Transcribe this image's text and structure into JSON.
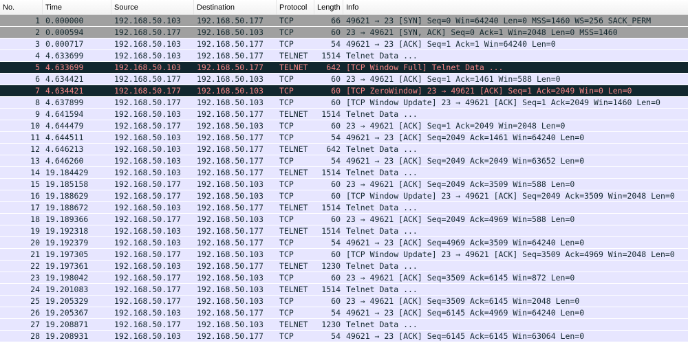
{
  "columns": {
    "no": "No.",
    "time": "Time",
    "source": "Source",
    "destination": "Destination",
    "protocol": "Protocol",
    "length": "Length",
    "info": "Info"
  },
  "colors": {
    "row_default": "#e7e6ff",
    "row_syn": "#a0a0a0",
    "row_bad_bg": "#12272e",
    "row_bad_fg": "#f78787"
  },
  "packets": [
    {
      "no": "1",
      "time": "0.000000",
      "source": "192.168.50.103",
      "destination": "192.168.50.177",
      "protocol": "TCP",
      "length": "66",
      "info": "49621 → 23 [SYN] Seq=0 Win=64240 Len=0 MSS=1460 WS=256 SACK_PERM",
      "style": "syn"
    },
    {
      "no": "2",
      "time": "0.000594",
      "source": "192.168.50.177",
      "destination": "192.168.50.103",
      "protocol": "TCP",
      "length": "60",
      "info": "23 → 49621 [SYN, ACK] Seq=0 Ack=1 Win=2048 Len=0 MSS=1460",
      "style": "syn"
    },
    {
      "no": "3",
      "time": "0.000717",
      "source": "192.168.50.103",
      "destination": "192.168.50.177",
      "protocol": "TCP",
      "length": "54",
      "info": "49621 → 23 [ACK] Seq=1 Ack=1 Win=64240 Len=0",
      "style": "normal"
    },
    {
      "no": "4",
      "time": "4.633699",
      "source": "192.168.50.103",
      "destination": "192.168.50.177",
      "protocol": "TELNET",
      "length": "1514",
      "info": "Telnet Data ...",
      "style": "normal"
    },
    {
      "no": "5",
      "time": "4.633699",
      "source": "192.168.50.103",
      "destination": "192.168.50.177",
      "protocol": "TELNET",
      "length": "642",
      "info": "[TCP Window Full] Telnet Data ...",
      "style": "bad"
    },
    {
      "no": "6",
      "time": "4.634421",
      "source": "192.168.50.177",
      "destination": "192.168.50.103",
      "protocol": "TCP",
      "length": "60",
      "info": "23 → 49621 [ACK] Seq=1 Ack=1461 Win=588 Len=0",
      "style": "normal"
    },
    {
      "no": "7",
      "time": "4.634421",
      "source": "192.168.50.177",
      "destination": "192.168.50.103",
      "protocol": "TCP",
      "length": "60",
      "info": "[TCP ZeroWindow] 23 → 49621 [ACK] Seq=1 Ack=2049 Win=0 Len=0",
      "style": "bad"
    },
    {
      "no": "8",
      "time": "4.637899",
      "source": "192.168.50.177",
      "destination": "192.168.50.103",
      "protocol": "TCP",
      "length": "60",
      "info": "[TCP Window Update] 23 → 49621 [ACK] Seq=1 Ack=2049 Win=1460 Len=0",
      "style": "normal"
    },
    {
      "no": "9",
      "time": "4.641594",
      "source": "192.168.50.103",
      "destination": "192.168.50.177",
      "protocol": "TELNET",
      "length": "1514",
      "info": "Telnet Data ...",
      "style": "normal"
    },
    {
      "no": "10",
      "time": "4.644479",
      "source": "192.168.50.177",
      "destination": "192.168.50.103",
      "protocol": "TCP",
      "length": "60",
      "info": "23 → 49621 [ACK] Seq=1 Ack=2049 Win=2048 Len=0",
      "style": "normal"
    },
    {
      "no": "11",
      "time": "4.644511",
      "source": "192.168.50.103",
      "destination": "192.168.50.177",
      "protocol": "TCP",
      "length": "54",
      "info": "49621 → 23 [ACK] Seq=2049 Ack=1461 Win=64240 Len=0",
      "style": "normal"
    },
    {
      "no": "12",
      "time": "4.646213",
      "source": "192.168.50.103",
      "destination": "192.168.50.177",
      "protocol": "TELNET",
      "length": "642",
      "info": "Telnet Data ...",
      "style": "normal"
    },
    {
      "no": "13",
      "time": "4.646260",
      "source": "192.168.50.103",
      "destination": "192.168.50.177",
      "protocol": "TCP",
      "length": "54",
      "info": "49621 → 23 [ACK] Seq=2049 Ack=2049 Win=63652 Len=0",
      "style": "normal"
    },
    {
      "no": "14",
      "time": "19.184429",
      "source": "192.168.50.103",
      "destination": "192.168.50.177",
      "protocol": "TELNET",
      "length": "1514",
      "info": "Telnet Data ...",
      "style": "normal"
    },
    {
      "no": "15",
      "time": "19.185158",
      "source": "192.168.50.177",
      "destination": "192.168.50.103",
      "protocol": "TCP",
      "length": "60",
      "info": "23 → 49621 [ACK] Seq=2049 Ack=3509 Win=588 Len=0",
      "style": "normal"
    },
    {
      "no": "16",
      "time": "19.188629",
      "source": "192.168.50.177",
      "destination": "192.168.50.103",
      "protocol": "TCP",
      "length": "60",
      "info": "[TCP Window Update] 23 → 49621 [ACK] Seq=2049 Ack=3509 Win=2048 Len=0",
      "style": "normal"
    },
    {
      "no": "17",
      "time": "19.188672",
      "source": "192.168.50.103",
      "destination": "192.168.50.177",
      "protocol": "TELNET",
      "length": "1514",
      "info": "Telnet Data ...",
      "style": "normal"
    },
    {
      "no": "18",
      "time": "19.189366",
      "source": "192.168.50.177",
      "destination": "192.168.50.103",
      "protocol": "TCP",
      "length": "60",
      "info": "23 → 49621 [ACK] Seq=2049 Ack=4969 Win=588 Len=0",
      "style": "normal"
    },
    {
      "no": "19",
      "time": "19.192318",
      "source": "192.168.50.103",
      "destination": "192.168.50.177",
      "protocol": "TELNET",
      "length": "1514",
      "info": "Telnet Data ...",
      "style": "normal"
    },
    {
      "no": "20",
      "time": "19.192379",
      "source": "192.168.50.103",
      "destination": "192.168.50.177",
      "protocol": "TCP",
      "length": "54",
      "info": "49621 → 23 [ACK] Seq=4969 Ack=3509 Win=64240 Len=0",
      "style": "normal"
    },
    {
      "no": "21",
      "time": "19.197305",
      "source": "192.168.50.177",
      "destination": "192.168.50.103",
      "protocol": "TCP",
      "length": "60",
      "info": "[TCP Window Update] 23 → 49621 [ACK] Seq=3509 Ack=4969 Win=2048 Len=0",
      "style": "normal"
    },
    {
      "no": "22",
      "time": "19.197361",
      "source": "192.168.50.103",
      "destination": "192.168.50.177",
      "protocol": "TELNET",
      "length": "1230",
      "info": "Telnet Data ...",
      "style": "normal"
    },
    {
      "no": "23",
      "time": "19.198042",
      "source": "192.168.50.177",
      "destination": "192.168.50.103",
      "protocol": "TCP",
      "length": "60",
      "info": "23 → 49621 [ACK] Seq=3509 Ack=6145 Win=872 Len=0",
      "style": "normal"
    },
    {
      "no": "24",
      "time": "19.201083",
      "source": "192.168.50.177",
      "destination": "192.168.50.103",
      "protocol": "TELNET",
      "length": "1514",
      "info": "Telnet Data ...",
      "style": "normal"
    },
    {
      "no": "25",
      "time": "19.205329",
      "source": "192.168.50.177",
      "destination": "192.168.50.103",
      "protocol": "TCP",
      "length": "60",
      "info": "23 → 49621 [ACK] Seq=3509 Ack=6145 Win=2048 Len=0",
      "style": "normal"
    },
    {
      "no": "26",
      "time": "19.205367",
      "source": "192.168.50.103",
      "destination": "192.168.50.177",
      "protocol": "TCP",
      "length": "54",
      "info": "49621 → 23 [ACK] Seq=6145 Ack=4969 Win=64240 Len=0",
      "style": "normal"
    },
    {
      "no": "27",
      "time": "19.208871",
      "source": "192.168.50.177",
      "destination": "192.168.50.103",
      "protocol": "TELNET",
      "length": "1230",
      "info": "Telnet Data ...",
      "style": "normal"
    },
    {
      "no": "28",
      "time": "19.208931",
      "source": "192.168.50.103",
      "destination": "192.168.50.177",
      "protocol": "TCP",
      "length": "54",
      "info": "49621 → 23 [ACK] Seq=6145 Ack=6145 Win=63064 Len=0",
      "style": "normal"
    }
  ]
}
